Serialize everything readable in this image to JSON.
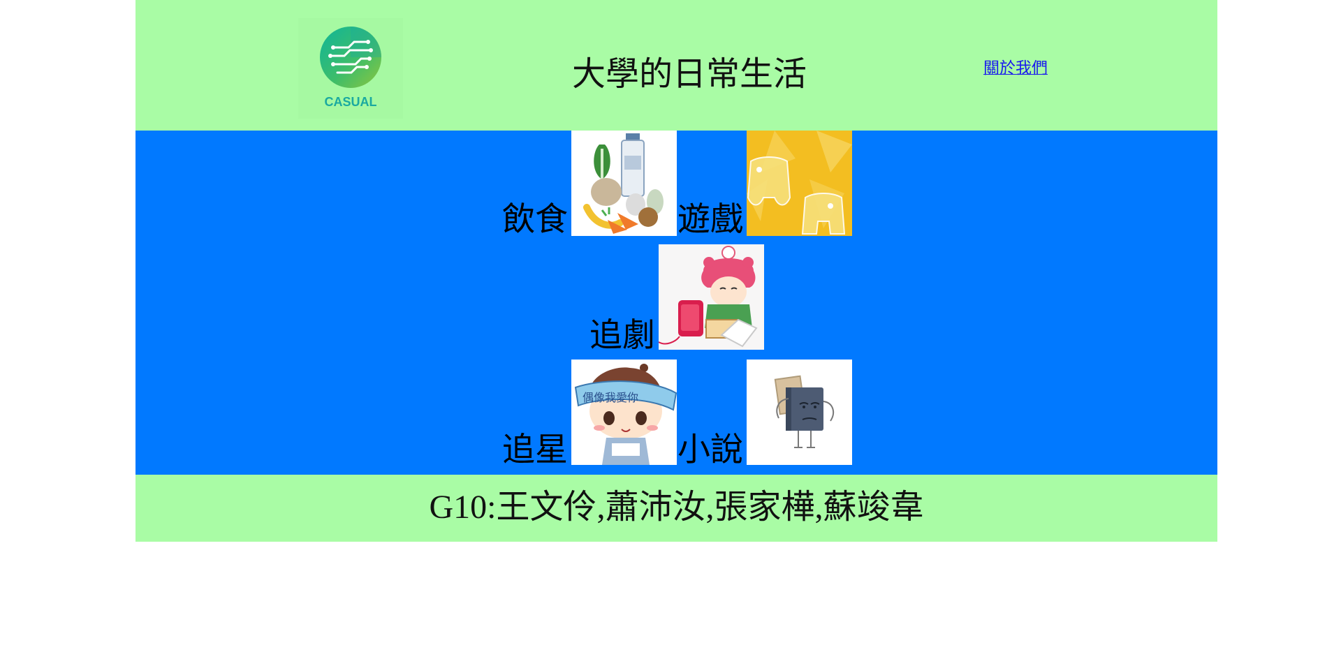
{
  "header": {
    "logo_text": "CASUAL",
    "title": "大學的日常生活",
    "about_link": "關於我們"
  },
  "categories": [
    {
      "label": "飲食",
      "image": "groceries-vegetables-milk-bread-image"
    },
    {
      "label": "遊戲",
      "image": "yellow-game-controllers-image"
    },
    {
      "label": "追劇",
      "image": "cartoon-girl-watching-tv-image"
    },
    {
      "label": "追星",
      "image": "cartoon-boy-headband-image"
    },
    {
      "label": "小說",
      "image": "cartoon-book-character-image"
    }
  ],
  "footer": {
    "credits": "G10:王文伶,蕭沛汝,張家樺,蘇竣韋"
  },
  "colors": {
    "header_bg": "#a9fca5",
    "main_bg": "#0179ff",
    "footer_bg": "#a9fca5",
    "link": "#1a1aee"
  }
}
